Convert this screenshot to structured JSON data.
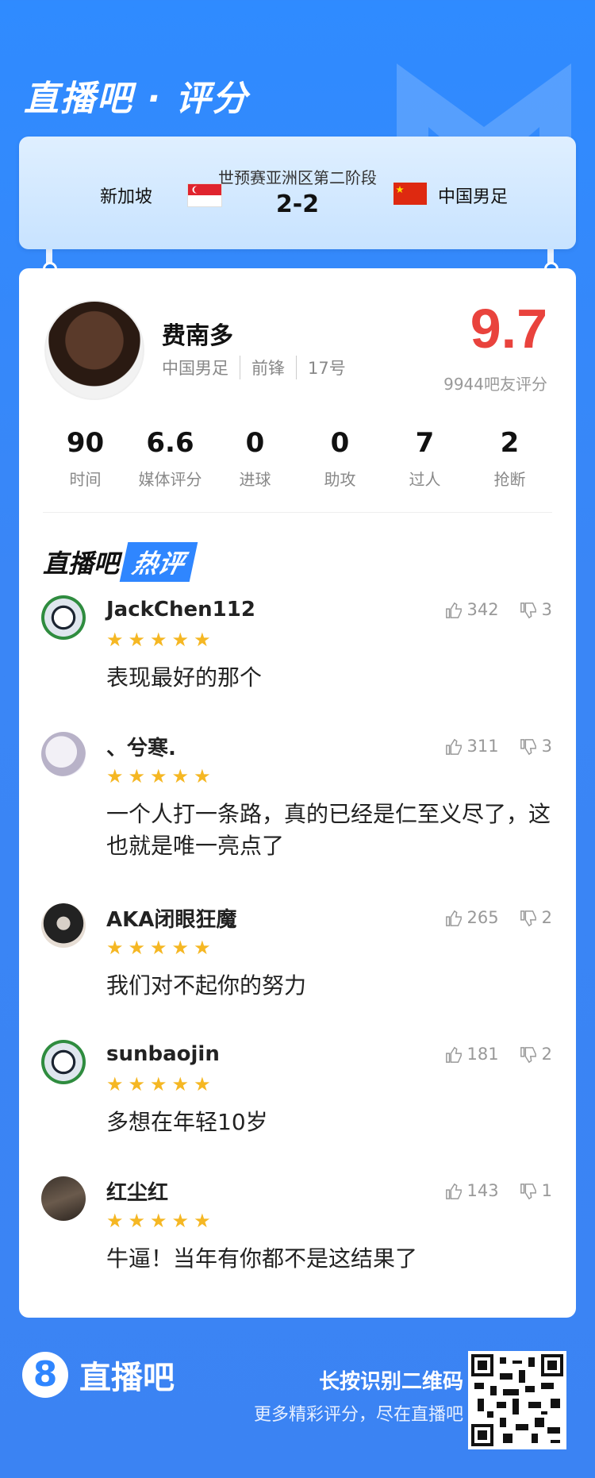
{
  "header": {
    "title": "直播吧 · 评分"
  },
  "match": {
    "stage": "世预赛亚洲区第二阶段",
    "score": "2-2",
    "home": "新加坡",
    "away": "中国男足"
  },
  "player": {
    "name": "费南多",
    "team": "中国男足",
    "position": "前锋",
    "number": "17号",
    "rating": "9.7",
    "rating_label": "9944吧友评分",
    "stats": [
      {
        "value": "90",
        "label": "时间"
      },
      {
        "value": "6.6",
        "label": "媒体评分"
      },
      {
        "value": "0",
        "label": "进球"
      },
      {
        "value": "0",
        "label": "助攻"
      },
      {
        "value": "7",
        "label": "过人"
      },
      {
        "value": "2",
        "label": "抢断"
      }
    ]
  },
  "hot": {
    "prefix": "直播吧",
    "badge": "热评"
  },
  "comments": [
    {
      "user": "JackChen112",
      "likes": "342",
      "dislikes": "3",
      "stars": "★★★★★",
      "text": "表现最好的那个"
    },
    {
      "user": "、兮寒.",
      "likes": "311",
      "dislikes": "3",
      "stars": "★★★★★",
      "text": "一个人打一条路，真的已经是仁至义尽了，这也就是唯一亮点了"
    },
    {
      "user": "AKA闭眼狂魔",
      "likes": "265",
      "dislikes": "2",
      "stars": "★★★★★",
      "text": "我们对不起你的努力"
    },
    {
      "user": "sunbaojin",
      "likes": "181",
      "dislikes": "2",
      "stars": "★★★★★",
      "text": "多想在年轻10岁"
    },
    {
      "user": "红尘红",
      "likes": "143",
      "dislikes": "1",
      "stars": "★★★★★",
      "text": "牛逼！当年有你都不是这结果了"
    }
  ],
  "footer": {
    "logo_glyph": "8",
    "logo_text": "直播吧",
    "line1": "长按识别二维码",
    "line2": "更多精彩评分，尽在直播吧"
  },
  "colors": {
    "accent": "#2f86ff",
    "rating": "#e9433d",
    "star": "#f5b723"
  }
}
